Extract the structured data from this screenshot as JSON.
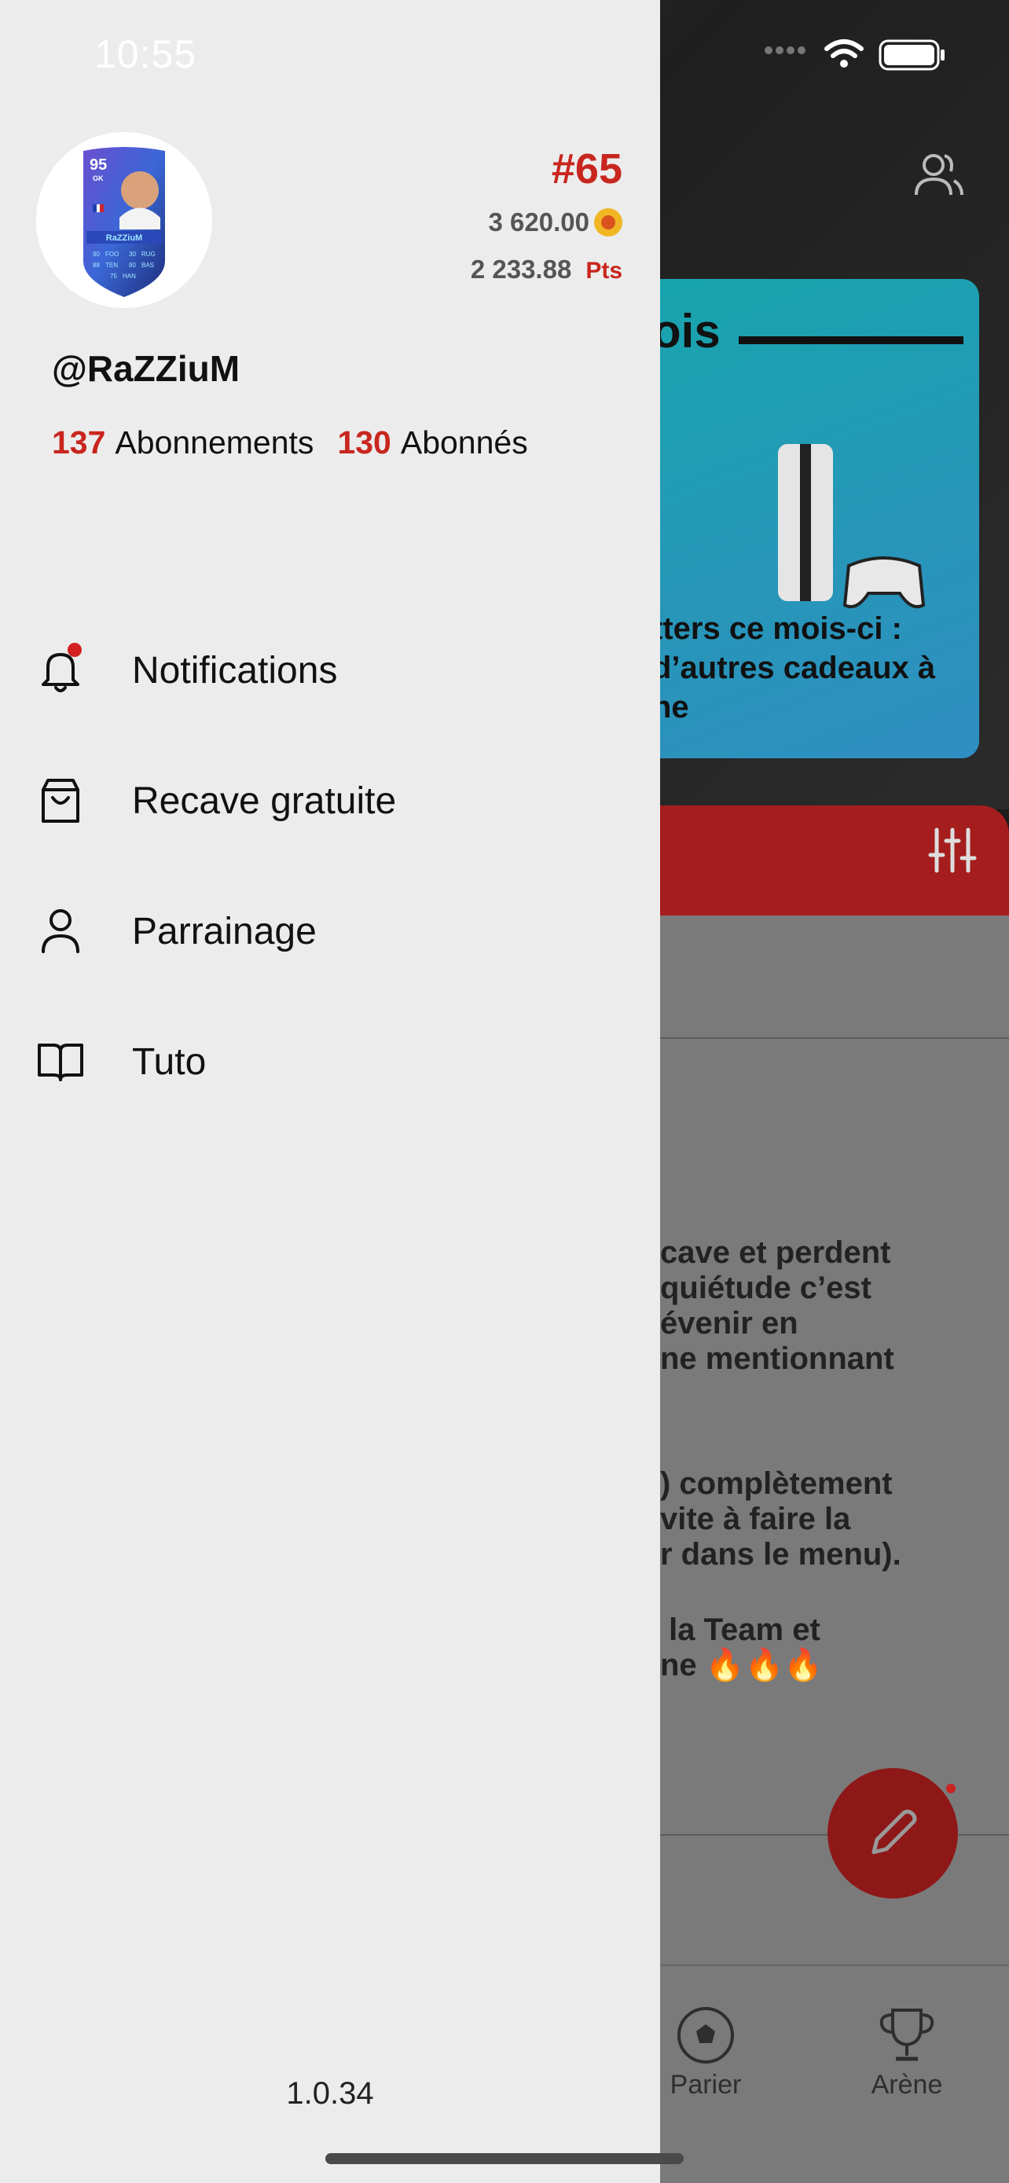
{
  "status_bar": {
    "time": "10:55"
  },
  "drawer": {
    "rank": "#65",
    "coins": "3 620.00",
    "points": "2 233.88",
    "points_label": "Pts",
    "username": "@RaZZiuM",
    "following_count": "137",
    "following_label": "Abonnements",
    "followers_count": "130",
    "followers_label": "Abonnés",
    "avatar_card": {
      "rating": "95",
      "position": "GK",
      "name": "RaZZiuM",
      "stats": [
        "90",
        "FOO",
        "30",
        "RUG",
        "88",
        "TEN",
        "80",
        "BAS",
        "75",
        "HAN"
      ]
    },
    "menu": [
      {
        "label": "Notifications",
        "icon": "bell-icon",
        "has_badge": true
      },
      {
        "label": "Recave gratuite",
        "icon": "shopping-bag-icon"
      },
      {
        "label": "Parrainage",
        "icon": "person-icon"
      },
      {
        "label": "Tuto",
        "icon": "book-open-icon"
      }
    ],
    "version": "1.0.34"
  },
  "background": {
    "card_title": "ois",
    "card_text": "tters ce mois-ci :\nd’autres cadeaux à\nne",
    "body_text_1": "cave et perdent\nquiétude c’est\névenir en\nne mentionnant",
    "body_text_2": ") complètement\nvite à faire la\nr dans le menu).",
    "body_text_3": " la Team et\nne 🔥🔥🔥",
    "tabs": [
      {
        "label": "Parier",
        "icon": "soccer-ball-icon"
      },
      {
        "label": "Arène",
        "icon": "trophy-icon"
      }
    ]
  },
  "colors": {
    "accent_red": "#c8261e",
    "drawer_bg": "#ececec",
    "card_teal": "#16a6ac",
    "fab_red": "#8e1818"
  }
}
